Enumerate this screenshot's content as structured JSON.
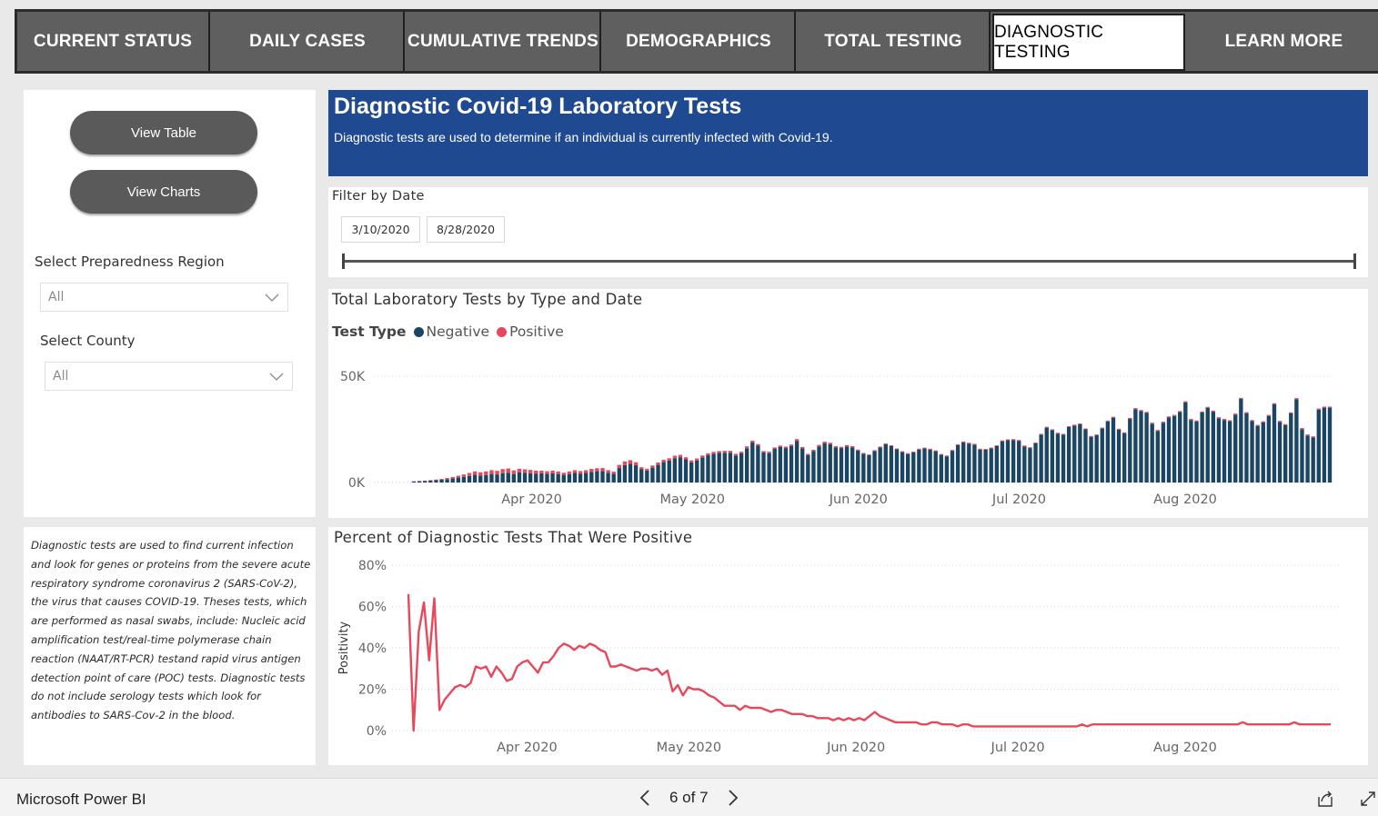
{
  "nav": {
    "tabs": [
      {
        "label": "CURRENT STATUS",
        "active": false
      },
      {
        "label": "DAILY CASES",
        "active": false
      },
      {
        "label": "CUMULATIVE TRENDS",
        "active": false
      },
      {
        "label": "DEMOGRAPHICS",
        "active": false
      },
      {
        "label": "TOTAL TESTING",
        "active": false
      },
      {
        "label": "DIAGNOSTIC TESTING",
        "active": true
      },
      {
        "label": "LEARN MORE",
        "active": false
      }
    ]
  },
  "sidebar": {
    "view_table": "View Table",
    "view_charts": "View Charts",
    "region_label": "Select Preparedness Region",
    "region_value": "All",
    "county_label": "Select County",
    "county_value": "All",
    "description": "Diagnostic tests are used to find current infection and look for genes or proteins from the severe acute respiratory syndrome coronavirus 2 (SARS-CoV-2), the virus that causes COVID-19. Theses tests, which are performed as nasal swabs, include: Nucleic acid amplification test/real-time polymerase chain reaction (NAAT/RT-PCR) testand rapid virus antigen detection point of care (POC) tests.  Diagnostic tests do not include serology tests which look for antibodies to SARS-Cov-2 in the blood."
  },
  "banner": {
    "title": "Diagnostic Covid-19 Laboratory Tests",
    "subtitle": "Diagnostic tests are used to determine if an individual is currently infected with Covid-19."
  },
  "date_filter": {
    "title": "Filter by Date",
    "start": "3/10/2020",
    "end": "8/28/2020"
  },
  "colors": {
    "negative": "#1a4565",
    "positive": "#e8485b",
    "banner": "#1f4a91"
  },
  "footer": {
    "brand": "Microsoft Power BI",
    "page": "6 of 7",
    "prev_icon": "chevron-left-icon",
    "next_icon": "chevron-right-icon",
    "share_icon": "share-icon",
    "fullscreen_icon": "fullscreen-icon"
  },
  "chart_data": [
    {
      "type": "bar",
      "stacked": true,
      "title": "Total Laboratory Tests by Type and Date",
      "legend_title": "Test Type",
      "legend_position": "top-left",
      "x_start": "2020-03-10",
      "x_end": "2020-08-28",
      "x_ticks": [
        "Apr 2020",
        "May 2020",
        "Jun 2020",
        "Jul 2020",
        "Aug 2020"
      ],
      "y_ticks": [
        "50K",
        "0K"
      ],
      "ylim": [
        0,
        50000
      ],
      "grid": true,
      "series": [
        {
          "name": "Negative",
          "values": [
            500,
            600,
            700,
            900,
            1100,
            1300,
            1600,
            1900,
            2300,
            2700,
            3100,
            3600,
            3300,
            3500,
            4000,
            3800,
            4400,
            4600,
            4000,
            4700,
            4600,
            4400,
            4200,
            4300,
            4100,
            4300,
            4000,
            3600,
            4000,
            4500,
            4200,
            4500,
            5000,
            5300,
            5400,
            4600,
            4100,
            6800,
            8200,
            8800,
            8100,
            6200,
            5600,
            7000,
            8300,
            9600,
            10300,
            11400,
            11900,
            10900,
            9500,
            10400,
            11800,
            12800,
            13500,
            13900,
            14000,
            14000,
            12700,
            13700,
            16100,
            18800,
            17300,
            14100,
            13800,
            15800,
            16700,
            16200,
            17200,
            19600,
            16000,
            12900,
            14800,
            17000,
            18500,
            18000,
            16500,
            16200,
            17000,
            16500,
            15000,
            13500,
            12800,
            14800,
            16500,
            18000,
            17100,
            15600,
            14300,
            13400,
            14100,
            15500,
            16000,
            15500,
            14700,
            13000,
            12300,
            14900,
            17600,
            18900,
            18300,
            17800,
            15500,
            15400,
            16000,
            17100,
            19400,
            19900,
            20000,
            19600,
            17000,
            16200,
            18400,
            22500,
            25800,
            24600,
            23000,
            22500,
            26100,
            26800,
            27400,
            25000,
            21500,
            22200,
            25400,
            28700,
            30500,
            24900,
            23200,
            29900,
            34500,
            33600,
            32700,
            27600,
            24200,
            28100,
            30600,
            31300,
            33100,
            37700,
            29400,
            28700,
            32900,
            35100,
            33300,
            30200,
            29400,
            28800,
            31900,
            39300,
            32600,
            28900,
            26600,
            28300,
            31300,
            36800,
            28500,
            27000,
            32500,
            39200,
            25100,
            22100,
            21200,
            34300,
            35200,
            35200
          ],
          "note": "bar heights estimated from pixels"
        },
        {
          "name": "Positive",
          "values": [
            100,
            150,
            200,
            250,
            300,
            400,
            500,
            700,
            900,
            1100,
            1400,
            1600,
            1500,
            1700,
            1800,
            1700,
            1900,
            2000,
            1700,
            1800,
            1600,
            1500,
            1400,
            1300,
            1200,
            1300,
            1200,
            1000,
            1200,
            1300,
            1200,
            1300,
            1400,
            1400,
            1400,
            1200,
            1000,
            1500,
            1700,
            1700,
            1400,
            1000,
            900,
            1000,
            1100,
            1100,
            1100,
            1200,
            1100,
            1000,
            900,
            900,
            900,
            900,
            900,
            900,
            900,
            900,
            800,
            800,
            900,
            900,
            800,
            700,
            700,
            700,
            700,
            700,
            700,
            800,
            700,
            600,
            600,
            700,
            700,
            700,
            600,
            600,
            600,
            600,
            500,
            400,
            400,
            400,
            400,
            400,
            400,
            400,
            400,
            400,
            400,
            400,
            400,
            400,
            400,
            400,
            400,
            400,
            400,
            400,
            400,
            400,
            400,
            400,
            400,
            400,
            400,
            400,
            400,
            400,
            400,
            400,
            400,
            400,
            400,
            400,
            400,
            400,
            400,
            400,
            400,
            400,
            400,
            400,
            400,
            400,
            400,
            400,
            400,
            500,
            500,
            500,
            500,
            500,
            500,
            500,
            500,
            500,
            500,
            500,
            500,
            500,
            500,
            500,
            500,
            500,
            500,
            500,
            500,
            500,
            500,
            500,
            500,
            500,
            500,
            500,
            500,
            500,
            500,
            500,
            500,
            500,
            500,
            500,
            500,
            500
          ]
        }
      ]
    },
    {
      "type": "line",
      "title": "Percent of Diagnostic Tests That Were Positive",
      "ylabel": "Positivity",
      "x_start": "2020-03-10",
      "x_end": "2020-08-28",
      "x_ticks": [
        "Apr 2020",
        "May 2020",
        "Jun 2020",
        "Jul 2020",
        "Aug 2020"
      ],
      "y_ticks": [
        "80%",
        "60%",
        "40%",
        "20%",
        "0%"
      ],
      "ylim": [
        0,
        80
      ],
      "grid": true,
      "series": [
        {
          "name": "Positivity",
          "values": [
            66,
            0,
            48,
            62,
            34,
            64,
            10,
            15,
            18,
            21,
            22,
            21,
            23,
            31,
            30,
            31,
            26,
            31,
            28,
            24,
            25,
            31,
            33,
            34,
            31,
            28,
            33,
            33,
            36,
            40,
            42,
            41,
            39,
            41,
            40,
            42,
            41,
            39,
            38,
            31,
            31,
            32,
            31,
            30,
            29,
            30,
            30,
            29,
            30,
            27,
            29,
            19,
            22,
            17,
            21,
            20,
            20,
            19,
            17,
            16,
            14,
            12,
            12,
            12,
            10,
            12,
            11,
            11,
            11,
            10,
            9,
            10,
            10,
            9,
            8,
            8,
            8,
            7,
            7,
            6,
            6,
            6,
            5,
            6,
            5,
            6,
            5,
            6,
            5,
            7,
            9,
            7,
            6,
            5,
            4,
            4,
            4,
            4,
            4,
            3,
            3,
            4,
            4,
            3,
            3,
            3,
            2,
            3,
            3,
            2,
            2,
            2,
            2,
            2,
            2,
            2,
            2,
            2,
            2,
            2,
            2,
            2,
            2,
            2,
            2,
            2,
            2,
            2,
            2,
            2,
            3,
            2,
            3,
            3,
            3,
            3,
            3,
            3,
            3,
            3,
            3,
            3,
            3,
            3,
            3,
            3,
            3,
            3,
            3,
            3,
            3,
            3,
            3,
            3,
            3,
            3,
            3,
            3,
            3,
            3,
            3,
            4,
            3,
            3,
            3,
            3,
            3,
            3,
            3,
            3,
            3,
            4,
            3,
            3,
            3,
            3,
            3,
            3,
            3
          ]
        }
      ]
    }
  ]
}
